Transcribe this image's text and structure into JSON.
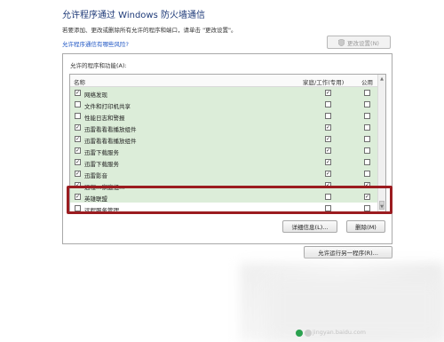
{
  "header": {
    "title": "允许程序通过 Windows 防火墙通信",
    "subtitle": "若要添加、更改或删除所有允许的程序和端口，请单击 \"更改设置\"。",
    "risk_link": "允许程序通信有哪些风险?",
    "change_settings_label": "更改设置(N)"
  },
  "panel": {
    "label": "允许的程序和功能(A):",
    "columns": {
      "name": "名称",
      "home": "家庭/工作(专用)",
      "public": "公用"
    },
    "rows": [
      {
        "name": "网络发现",
        "checked": true,
        "home": true,
        "public": false
      },
      {
        "name": "文件和打印机共享",
        "checked": false,
        "home": false,
        "public": false
      },
      {
        "name": "性能日志和警报",
        "checked": false,
        "home": false,
        "public": false
      },
      {
        "name": "迅雷看看看播放组件",
        "checked": true,
        "home": true,
        "public": false
      },
      {
        "name": "迅雷看看看播放组件",
        "checked": true,
        "home": true,
        "public": false
      },
      {
        "name": "迅雷下载服务",
        "checked": true,
        "home": true,
        "public": false
      },
      {
        "name": "迅雷下载服务",
        "checked": true,
        "home": true,
        "public": false
      },
      {
        "name": "迅雷影音",
        "checked": true,
        "home": true,
        "public": false
      },
      {
        "name": "远程…家庭组…",
        "checked": true,
        "home": true,
        "public": true
      },
      {
        "name": "英雄联盟",
        "checked": true,
        "home": false,
        "public": true
      },
      {
        "name": "远程服务管理",
        "checked": false,
        "home": false,
        "public": false
      }
    ],
    "details_label": "详细信息(L)...",
    "delete_label": "删除(M)"
  },
  "allow_another_label": "允许运行另一程序(R)...",
  "watermark": "jingyan.baidu.com",
  "colors": {
    "row_green": "#dcedd9",
    "highlight_red": "#9b1c20",
    "link_blue": "#1f56c4",
    "title_blue": "#1e3a78"
  }
}
